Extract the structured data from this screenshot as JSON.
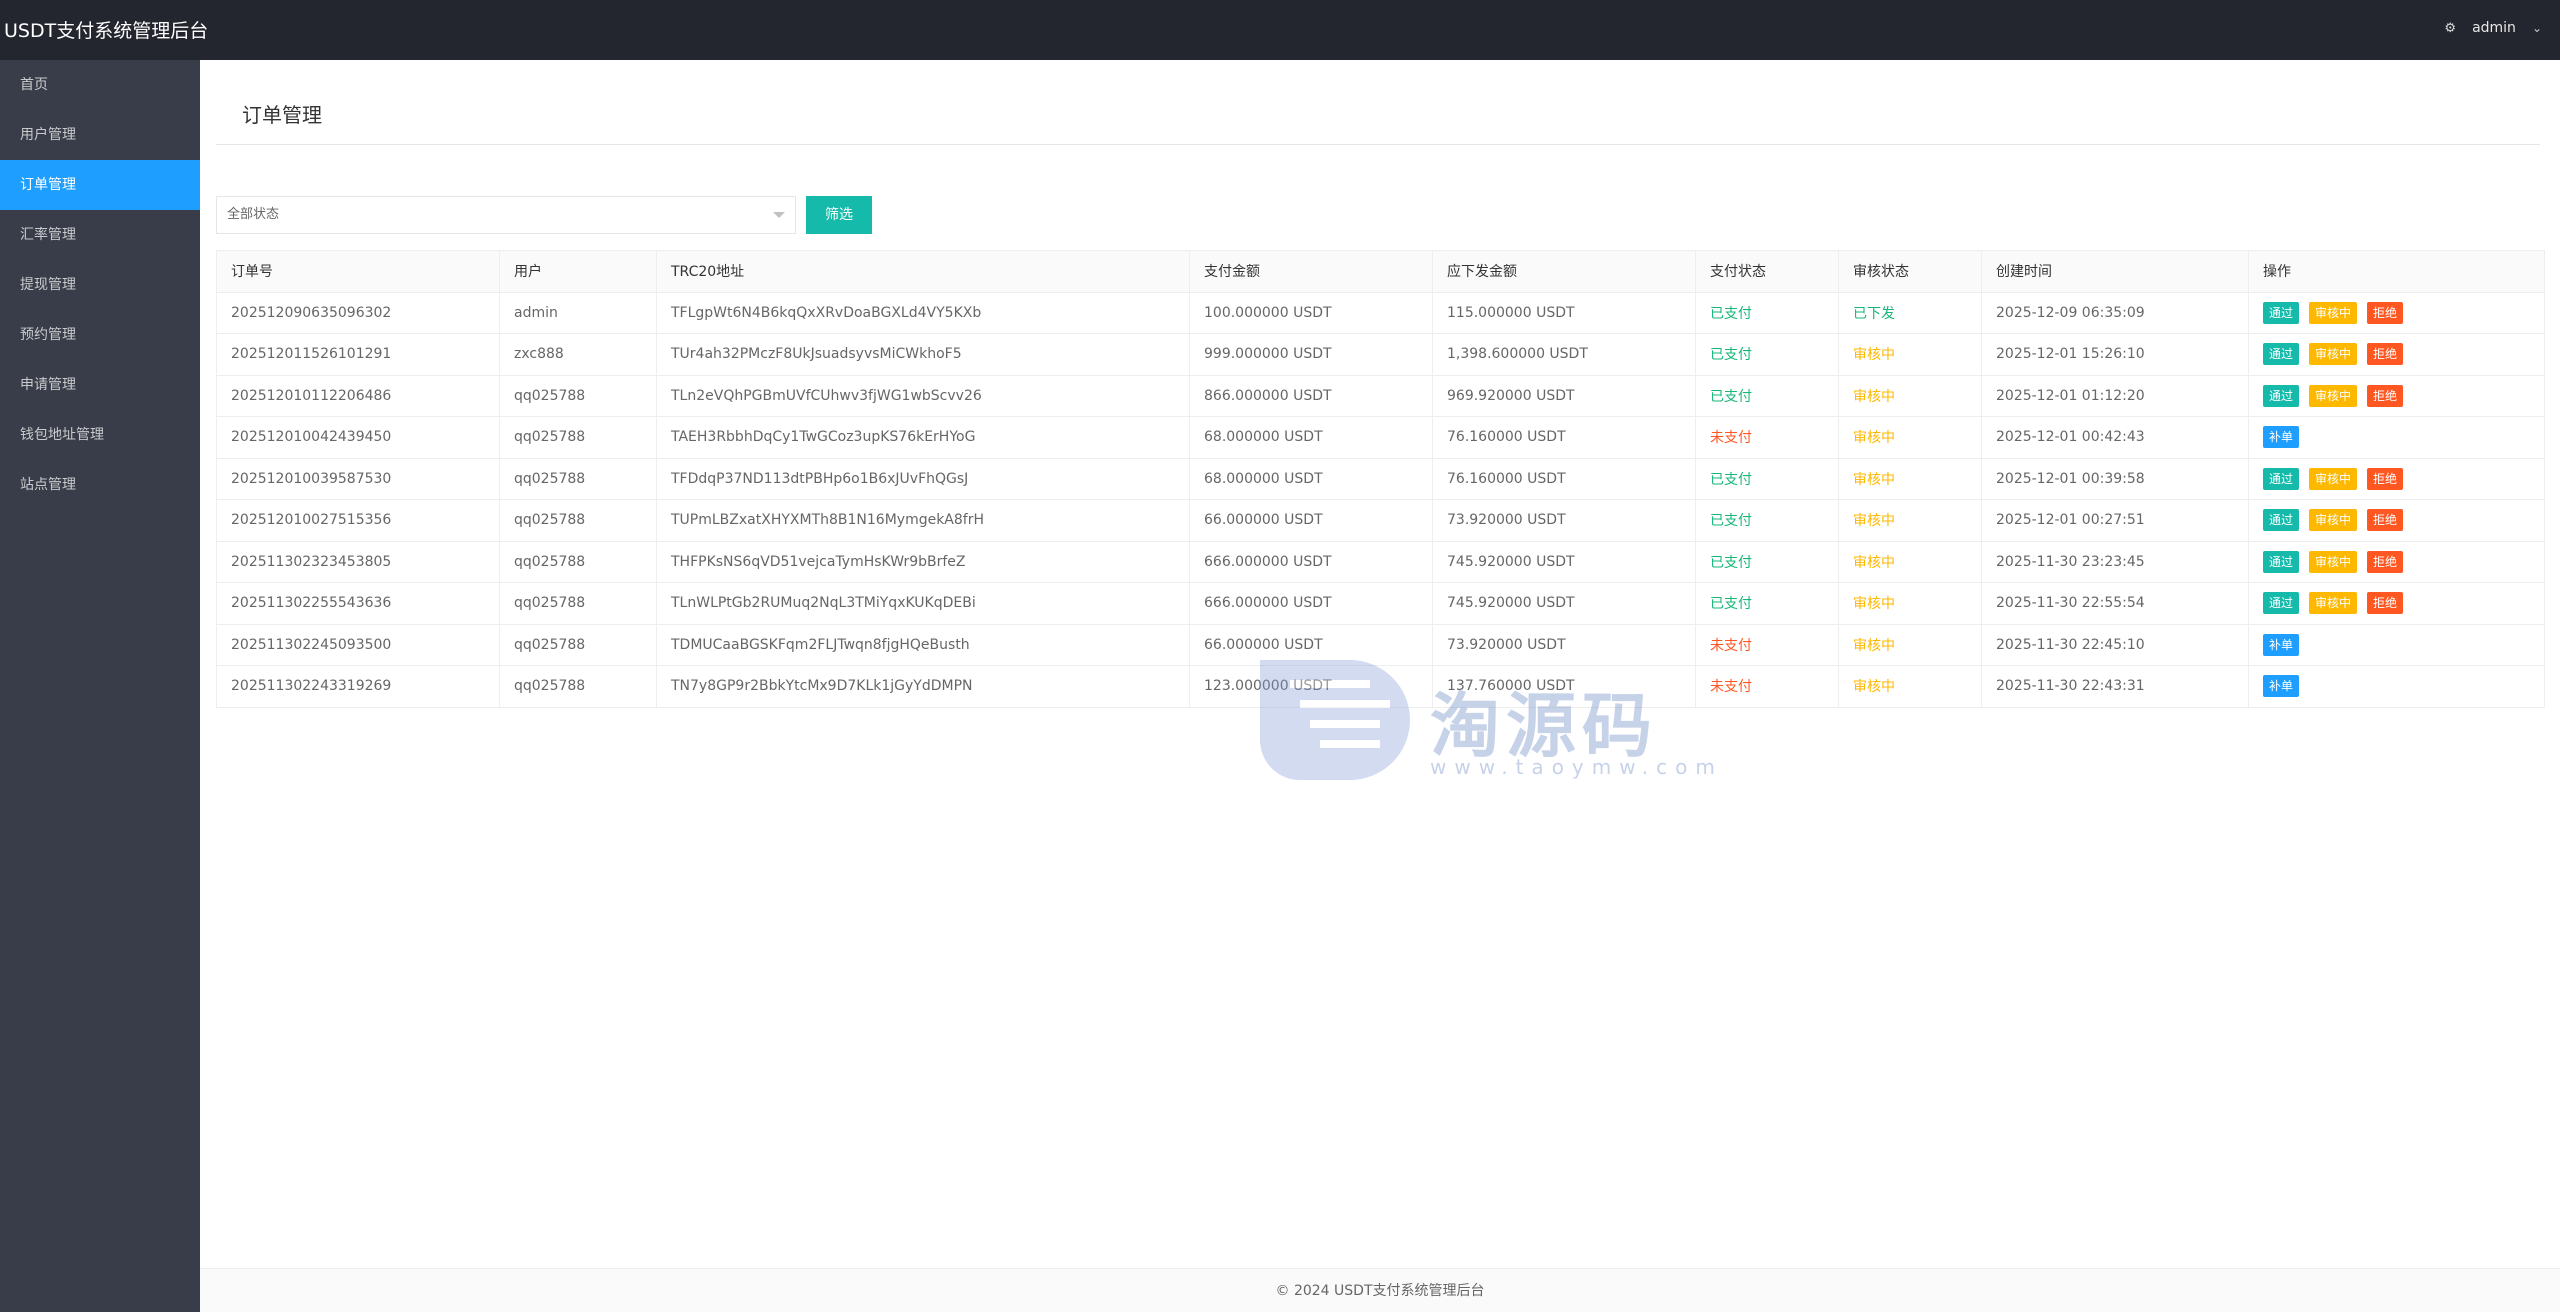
{
  "header": {
    "title": "USDT支付系统管理后台",
    "user": "admin"
  },
  "sidebar": {
    "items": [
      {
        "label": "首页"
      },
      {
        "label": "用户管理"
      },
      {
        "label": "订单管理"
      },
      {
        "label": "汇率管理"
      },
      {
        "label": "提现管理"
      },
      {
        "label": "预约管理"
      },
      {
        "label": "申请管理"
      },
      {
        "label": "钱包地址管理"
      },
      {
        "label": "站点管理"
      }
    ],
    "active_index": 2
  },
  "main": {
    "section_title": "订单管理",
    "filter": {
      "selected": "全部状态",
      "button_label": "筛选"
    }
  },
  "table": {
    "headers": [
      "订单号",
      "用户",
      "TRC20地址",
      "支付金额",
      "应下发金额",
      "支付状态",
      "审核状态",
      "创建时间",
      "操作"
    ],
    "op_labels": {
      "pass": "通过",
      "review": "审核中",
      "reject": "拒绝",
      "supplement": "补单"
    },
    "rows": [
      {
        "order": "202512090635096302",
        "user": "admin",
        "addr": "TFLgpWt6N4B6kqQxXRvDoaBGXLd4VY5KXb",
        "amount": "100.000000 USDT",
        "payout": "115.000000 USDT",
        "pay_status": "已支付",
        "audit_status": "已下发",
        "time": "2025-12-09 06:35:09",
        "ops": [
          "pass",
          "review",
          "reject"
        ]
      },
      {
        "order": "202512011526101291",
        "user": "zxc888",
        "addr": "TUr4ah32PMczF8UkJsuadsyvsMiCWkhoF5",
        "amount": "999.000000 USDT",
        "payout": "1,398.600000 USDT",
        "pay_status": "已支付",
        "audit_status": "审核中",
        "time": "2025-12-01 15:26:10",
        "ops": [
          "pass",
          "review",
          "reject"
        ]
      },
      {
        "order": "202512010112206486",
        "user": "qq025788",
        "addr": "TLn2eVQhPGBmUVfCUhwv3fjWG1wbScvv26",
        "amount": "866.000000 USDT",
        "payout": "969.920000 USDT",
        "pay_status": "已支付",
        "audit_status": "审核中",
        "time": "2025-12-01 01:12:20",
        "ops": [
          "pass",
          "review",
          "reject"
        ]
      },
      {
        "order": "202512010042439450",
        "user": "qq025788",
        "addr": "TAEH3RbbhDqCy1TwGCoz3upKS76kErHYoG",
        "amount": "68.000000 USDT",
        "payout": "76.160000 USDT",
        "pay_status": "未支付",
        "audit_status": "审核中",
        "time": "2025-12-01 00:42:43",
        "ops": [
          "supplement"
        ]
      },
      {
        "order": "202512010039587530",
        "user": "qq025788",
        "addr": "TFDdqP37ND113dtPBHp6o1B6xJUvFhQGsJ",
        "amount": "68.000000 USDT",
        "payout": "76.160000 USDT",
        "pay_status": "已支付",
        "audit_status": "审核中",
        "time": "2025-12-01 00:39:58",
        "ops": [
          "pass",
          "review",
          "reject"
        ]
      },
      {
        "order": "202512010027515356",
        "user": "qq025788",
        "addr": "TUPmLBZxatXHYXMTh8B1N16MymgekA8frH",
        "amount": "66.000000 USDT",
        "payout": "73.920000 USDT",
        "pay_status": "已支付",
        "audit_status": "审核中",
        "time": "2025-12-01 00:27:51",
        "ops": [
          "pass",
          "review",
          "reject"
        ]
      },
      {
        "order": "202511302323453805",
        "user": "qq025788",
        "addr": "THFPKsNS6qVD51vejcaTymHsKWr9bBrfeZ",
        "amount": "666.000000 USDT",
        "payout": "745.920000 USDT",
        "pay_status": "已支付",
        "audit_status": "审核中",
        "time": "2025-11-30 23:23:45",
        "ops": [
          "pass",
          "review",
          "reject"
        ]
      },
      {
        "order": "202511302255543636",
        "user": "qq025788",
        "addr": "TLnWLPtGb2RUMuq2NqL3TMiYqxKUKqDEBi",
        "amount": "666.000000 USDT",
        "payout": "745.920000 USDT",
        "pay_status": "已支付",
        "audit_status": "审核中",
        "time": "2025-11-30 22:55:54",
        "ops": [
          "pass",
          "review",
          "reject"
        ]
      },
      {
        "order": "202511302245093500",
        "user": "qq025788",
        "addr": "TDMUCaaBGSKFqm2FLJTwqn8fjgHQeBusth",
        "amount": "66.000000 USDT",
        "payout": "73.920000 USDT",
        "pay_status": "未支付",
        "audit_status": "审核中",
        "time": "2025-11-30 22:45:10",
        "ops": [
          "supplement"
        ]
      },
      {
        "order": "202511302243319269",
        "user": "qq025788",
        "addr": "TN7y8GP9r2BbkYtcMx9D7KLk1jGyYdDMPN",
        "amount": "123.000000 USDT",
        "payout": "137.760000 USDT",
        "pay_status": "未支付",
        "audit_status": "审核中",
        "time": "2025-11-30 22:43:31",
        "ops": [
          "supplement"
        ]
      }
    ]
  },
  "watermark": {
    "text": "淘源码",
    "url": "www.taoymw.com"
  },
  "footer": {
    "text": "© 2024 USDT支付系统管理后台"
  },
  "colors": {
    "header_bg": "#23262e",
    "sidebar_bg": "#393d49",
    "active_blue": "#1e9fff",
    "teal": "#16baaa",
    "yellow": "#ffb800",
    "orange_red": "#ff5722",
    "green": "#16b777"
  }
}
